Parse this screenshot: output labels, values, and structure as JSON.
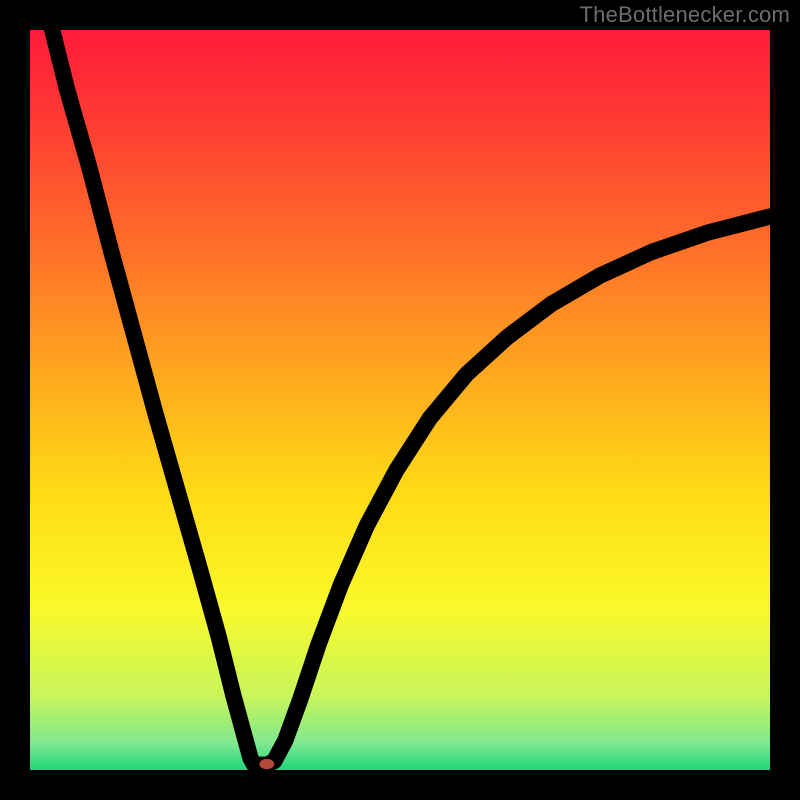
{
  "watermark": "TheBottlenecker.com",
  "chart_data": {
    "type": "line",
    "title": "",
    "xlabel": "",
    "ylabel": "",
    "xlim": [
      0,
      100
    ],
    "ylim": [
      0,
      100
    ],
    "grid": false,
    "legend": false,
    "gradient_stops": [
      {
        "offset": 0,
        "color": "#ff1b3a"
      },
      {
        "offset": 0.12,
        "color": "#ff3a33"
      },
      {
        "offset": 0.28,
        "color": "#ff6a2a"
      },
      {
        "offset": 0.45,
        "color": "#ffa31f"
      },
      {
        "offset": 0.62,
        "color": "#ffd916"
      },
      {
        "offset": 0.78,
        "color": "#faf92a"
      },
      {
        "offset": 0.9,
        "color": "#c8f55a"
      },
      {
        "offset": 0.965,
        "color": "#7de88f"
      },
      {
        "offset": 1.0,
        "color": "#1fd67a"
      }
    ],
    "curve": [
      {
        "x": 3.0,
        "y": 100.0
      },
      {
        "x": 5.0,
        "y": 92.0
      },
      {
        "x": 8.0,
        "y": 81.5
      },
      {
        "x": 11.0,
        "y": 70.0
      },
      {
        "x": 14.0,
        "y": 59.0
      },
      {
        "x": 17.0,
        "y": 48.0
      },
      {
        "x": 20.0,
        "y": 37.5
      },
      {
        "x": 23.0,
        "y": 27.0
      },
      {
        "x": 25.5,
        "y": 18.0
      },
      {
        "x": 27.5,
        "y": 10.0
      },
      {
        "x": 29.0,
        "y": 4.5
      },
      {
        "x": 29.8,
        "y": 1.6
      },
      {
        "x": 30.3,
        "y": 0.7
      },
      {
        "x": 31.0,
        "y": 0.7
      },
      {
        "x": 32.0,
        "y": 0.7
      },
      {
        "x": 33.0,
        "y": 1.2
      },
      {
        "x": 34.5,
        "y": 4.0
      },
      {
        "x": 36.5,
        "y": 9.5
      },
      {
        "x": 39.0,
        "y": 17.0
      },
      {
        "x": 42.0,
        "y": 25.0
      },
      {
        "x": 45.5,
        "y": 33.0
      },
      {
        "x": 49.5,
        "y": 40.5
      },
      {
        "x": 54.0,
        "y": 47.5
      },
      {
        "x": 59.0,
        "y": 53.5
      },
      {
        "x": 64.5,
        "y": 58.5
      },
      {
        "x": 70.5,
        "y": 63.0
      },
      {
        "x": 77.0,
        "y": 66.8
      },
      {
        "x": 84.0,
        "y": 70.0
      },
      {
        "x": 91.5,
        "y": 72.6
      },
      {
        "x": 100.0,
        "y": 74.8
      }
    ],
    "marker": {
      "x": 32.0,
      "y": 0.8,
      "rx": 1.0,
      "ry": 0.7
    }
  }
}
